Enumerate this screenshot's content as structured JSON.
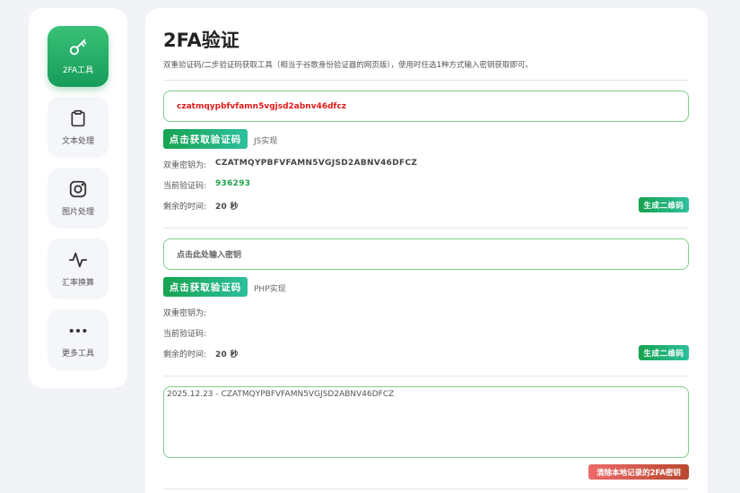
{
  "sidebar": {
    "items": [
      {
        "label": "2FA工具",
        "icon": "key-icon",
        "active": true
      },
      {
        "label": "文本处理",
        "icon": "clipboard-icon"
      },
      {
        "label": "图片处理",
        "icon": "instagram-icon"
      },
      {
        "label": "汇率换算",
        "icon": "pulse-icon"
      },
      {
        "label": "更多工具",
        "icon": "more-icon"
      }
    ]
  },
  "main": {
    "title": "2FA验证",
    "subtitle": "双重验证码/二步验证码获取工具（相当于谷歌身份验证器的网页版），使用时任选1种方式输入密钥获取即可。",
    "js": {
      "key_value": "czatmqypbfvfamn5vgjsd2abnv46dfcz",
      "get_btn": "点击获取验证码",
      "impl": "JS实现",
      "secret_label": "双重密钥为:",
      "secret_value": "CZATMQYPBFVFAMN5VGJSD2ABNV46DFCZ",
      "code_label": "当前验证码:",
      "code_value": "936293",
      "time_label": "剩余的时间:",
      "time_value": "20 秒",
      "qr_btn": "生成二维码"
    },
    "php": {
      "key_placeholder": "点击此处输入密钥",
      "get_btn": "点击获取验证码",
      "impl": "PHP实现",
      "secret_label": "双重密钥为:",
      "code_label": "当前验证码:",
      "time_label": "剩余的时间:",
      "time_value": "20 秒",
      "qr_btn": "生成二维码"
    },
    "history": {
      "text": "2025.12.23 - CZATMQYPBFVFAMN5VGJSD2ABNV46DFCZ"
    },
    "clear_btn": "清除本地记录的2FA密钥"
  },
  "colors": {
    "accent_green": "#169c5a",
    "key_red": "#e21a1a",
    "border_green": "#7dd08a",
    "clear_red": "#d95a4a"
  }
}
